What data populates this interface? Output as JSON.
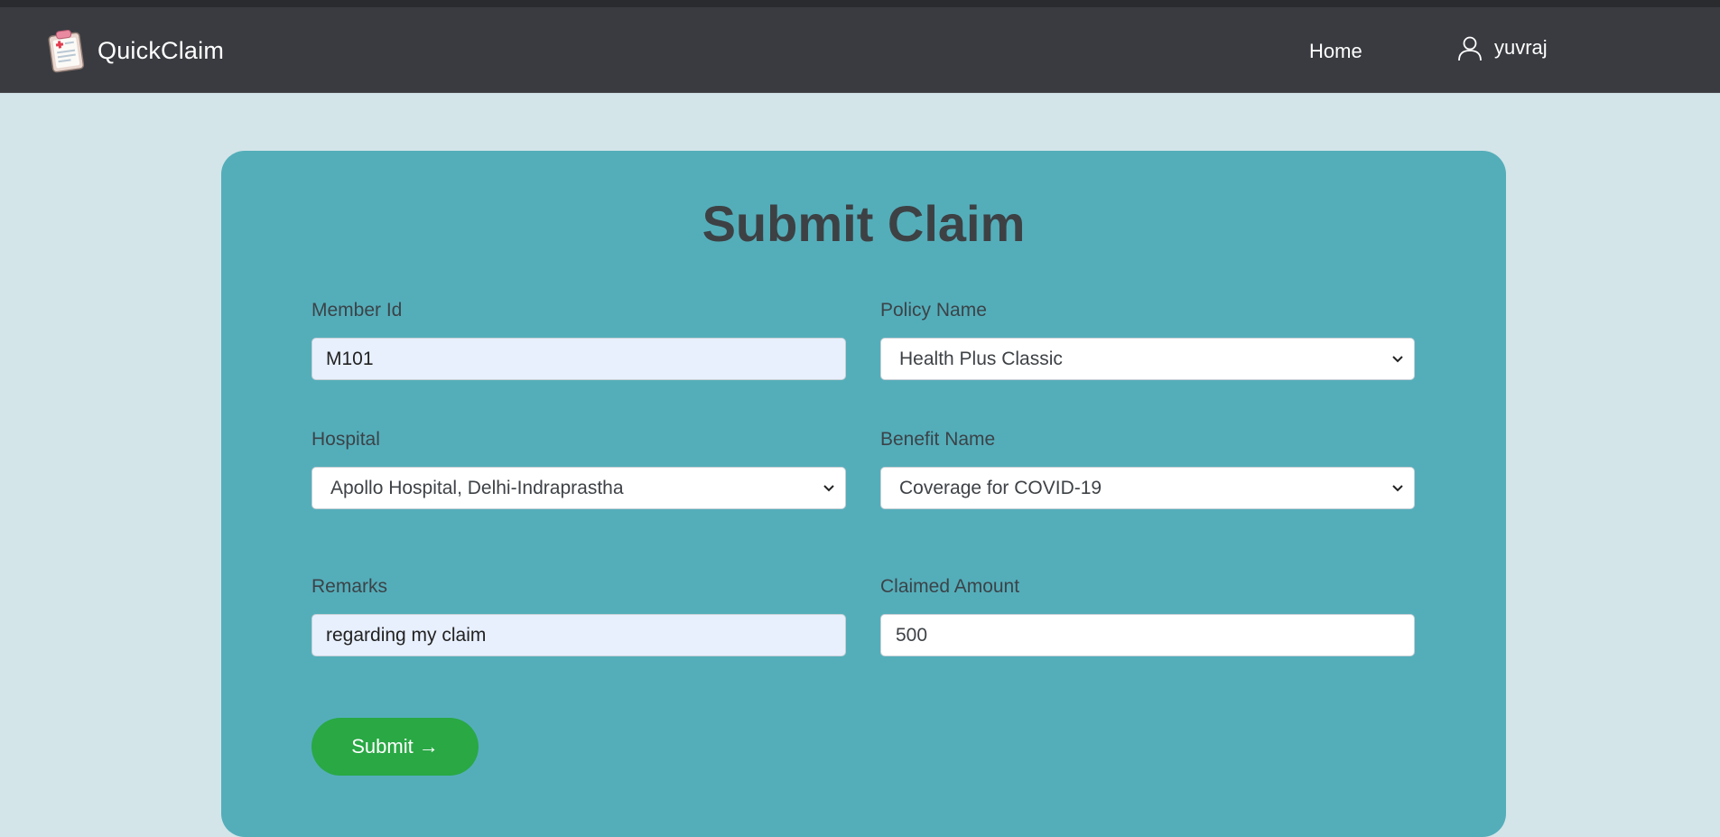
{
  "navbar": {
    "brand_name": "QuickClaim",
    "home_label": "Home",
    "username": "yuvraj"
  },
  "card": {
    "title": "Submit Claim"
  },
  "form": {
    "member_id": {
      "label": "Member Id",
      "value": "M101"
    },
    "policy_name": {
      "label": "Policy Name",
      "value": "Health Plus Classic"
    },
    "hospital": {
      "label": "Hospital",
      "value": "Apollo Hospital, Delhi-Indraprastha"
    },
    "benefit_name": {
      "label": "Benefit Name",
      "value": "Coverage for COVID-19"
    },
    "remarks": {
      "label": "Remarks",
      "value": "regarding my claim"
    },
    "claimed_amount": {
      "label": "Claimed Amount",
      "value": "500"
    },
    "submit_label": "Submit",
    "submit_arrow": "→"
  },
  "colors": {
    "navbar_bg": "#393b40",
    "page_bg": "#d3e5e9",
    "card_bg": "#54aeba",
    "submit_bg": "#29a844",
    "autofill_bg": "#e8f0fe"
  },
  "icons": {
    "brand": "clipboard-medical-icon",
    "user": "user-icon",
    "dropdown": "chevron-down-icon"
  }
}
